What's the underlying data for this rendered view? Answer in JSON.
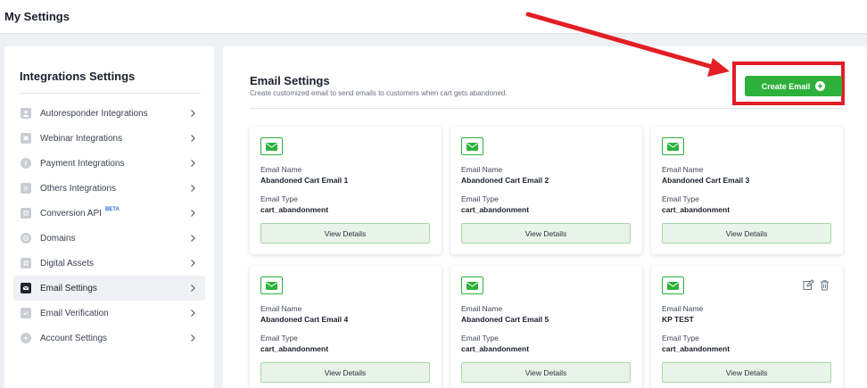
{
  "page": {
    "title": "My Settings"
  },
  "sidebar": {
    "heading": "Integrations Settings",
    "items": [
      {
        "label": "Autoresponder Integrations",
        "icon": "person-icon"
      },
      {
        "label": "Webinar Integrations",
        "icon": "webinar-icon"
      },
      {
        "label": "Payment Integrations",
        "icon": "payment-icon"
      },
      {
        "label": "Others Integrations",
        "icon": "document-icon"
      },
      {
        "label": "Conversion API",
        "badge": "BETA",
        "icon": "conversion-icon"
      },
      {
        "label": "Domains",
        "icon": "globe-icon"
      },
      {
        "label": "Digital Assets",
        "icon": "assets-icon"
      },
      {
        "label": "Email Settings",
        "icon": "mail-icon",
        "active": true
      },
      {
        "label": "Email Verification",
        "icon": "verification-icon"
      },
      {
        "label": "Account Settings",
        "icon": "gear-icon"
      }
    ]
  },
  "main": {
    "title": "Email Settings",
    "subtitle": "Create customized email to send emails to customers when cart gets abandoned.",
    "create_button": "Create Email",
    "field_labels": {
      "name": "Email Name",
      "type": "Email Type"
    },
    "view_details": "View Details",
    "cards": [
      {
        "name": "Abandoned Cart Email 1",
        "type": "cart_abandonment"
      },
      {
        "name": "Abandoned Cart Email 2",
        "type": "cart_abandonment"
      },
      {
        "name": "Abandoned Cart Email 3",
        "type": "cart_abandonment"
      },
      {
        "name": "Abandoned Cart Email 4",
        "type": "cart_abandonment"
      },
      {
        "name": "Abandoned Cart Email 5",
        "type": "cart_abandonment"
      },
      {
        "name": "KP TEST",
        "type": "cart_abandonment",
        "editable": true
      }
    ]
  },
  "colors": {
    "accent": "#2db13b",
    "annotation": "#e31e24"
  }
}
